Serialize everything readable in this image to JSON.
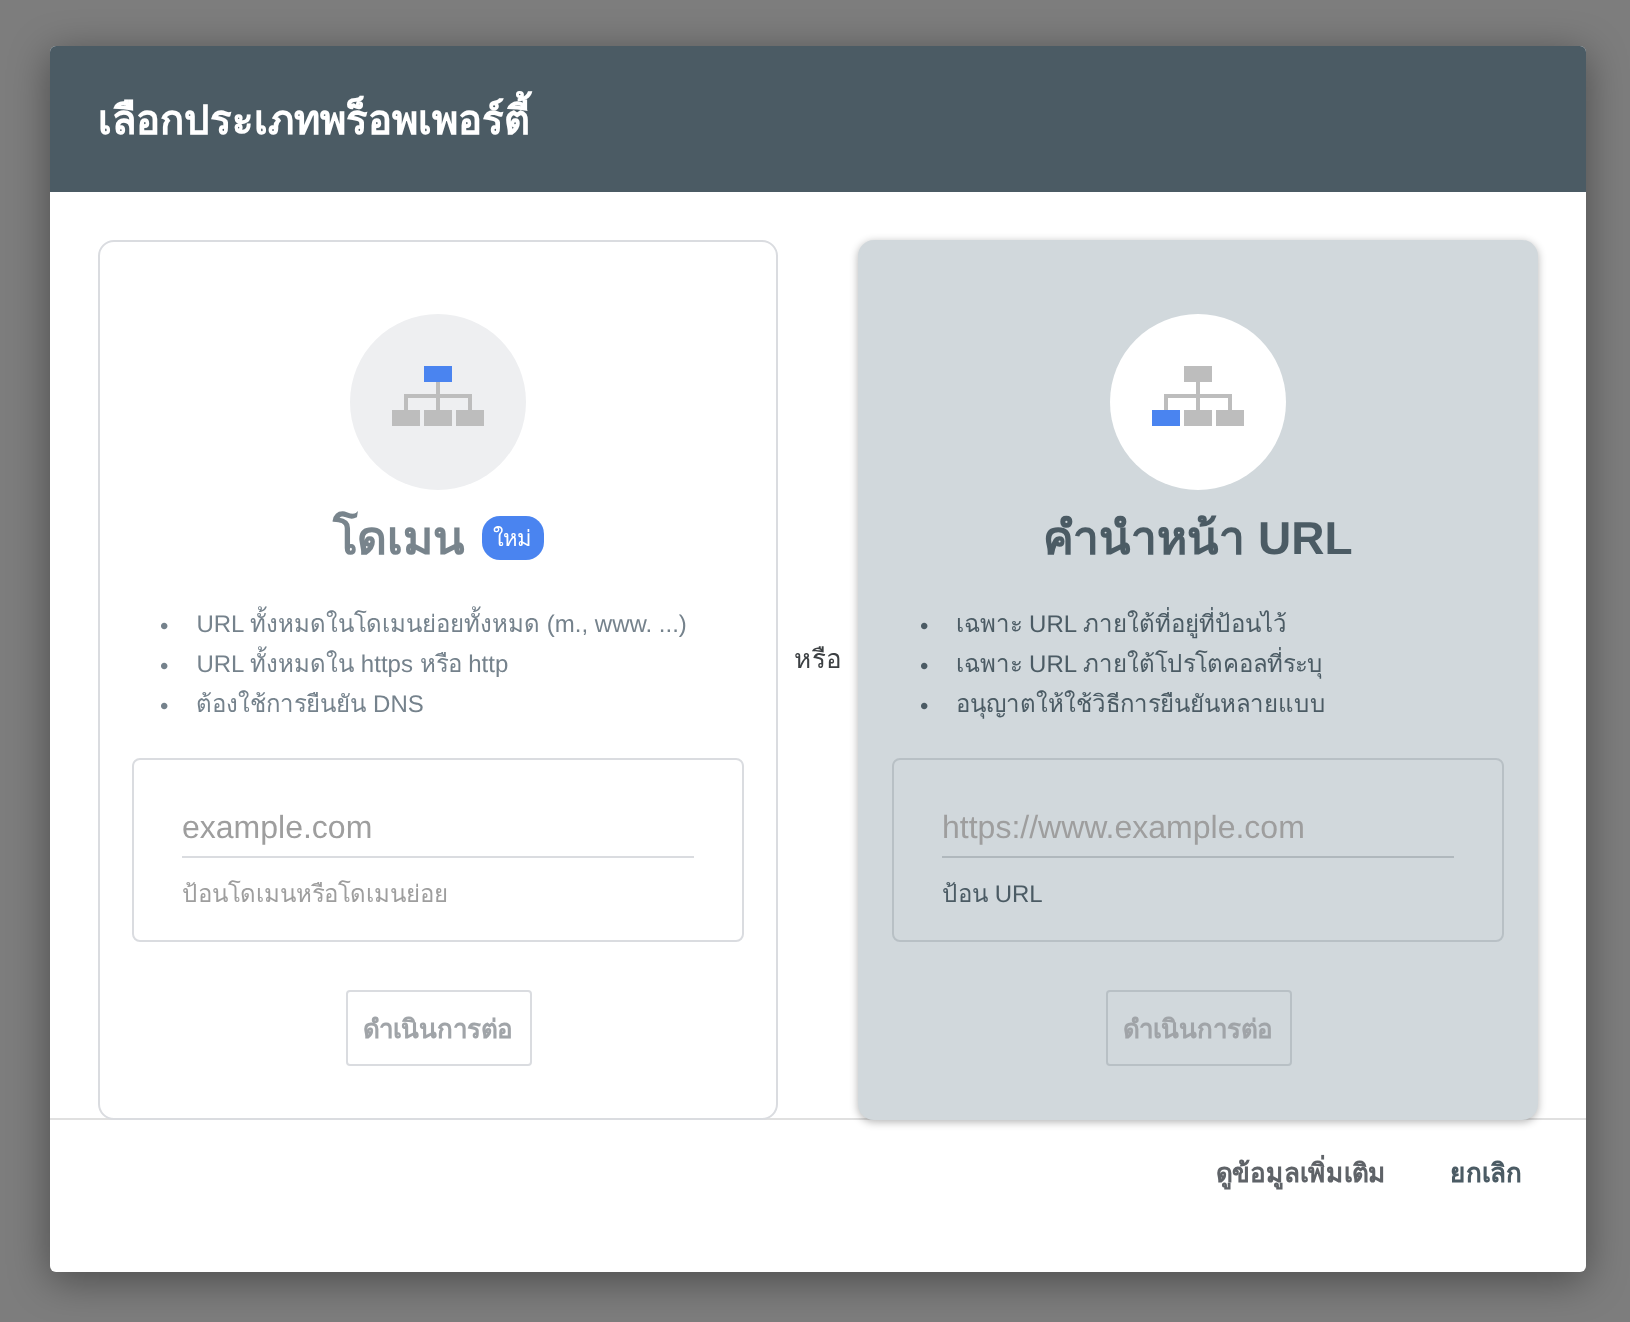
{
  "dialog": {
    "title": "เลือกประเภทพร็อพเพอร์ตี้"
  },
  "options": [
    {
      "title": "โดเมน",
      "badge": "ใหม่",
      "selected": false,
      "kind": "domain",
      "bullet_marker": "•",
      "bullets": [
        "URL ทั้งหมดในโดเมนย่อยทั้งหมด (m., www. ...)",
        "URL ทั้งหมดใน https หรือ http",
        "ต้องใช้การยืนยัน DNS"
      ],
      "field": {
        "placeholder": "example.com",
        "helper": "ป้อนโดเมนหรือโดเมนย่อย"
      },
      "button": {
        "label": "ดำเนินการต่อ",
        "disabled": true
      }
    },
    {
      "title": "คำนำหน้า URL",
      "selected": true,
      "kind": "url_prefix",
      "bullet_marker": "•",
      "bullets": [
        "เฉพาะ URL ภายใต้ที่อยู่ที่ป้อนไว้",
        "เฉพาะ URL ภายใต้โปรโตคอลที่ระบุ",
        "อนุญาตให้ใช้วิธีการยืนยันหลายแบบ"
      ],
      "field": {
        "placeholder": "https://www.example.com",
        "helper": "ป้อน URL"
      },
      "button": {
        "label": "ดำเนินการต่อ",
        "disabled": true
      }
    }
  ],
  "separator": "หรือ",
  "footer": {
    "buttons": [
      {
        "label": "ดูข้อมูลเพิ่มเติม",
        "kind": "secondary"
      },
      {
        "label": "ยกเลิก",
        "kind": "primary"
      }
    ]
  }
}
